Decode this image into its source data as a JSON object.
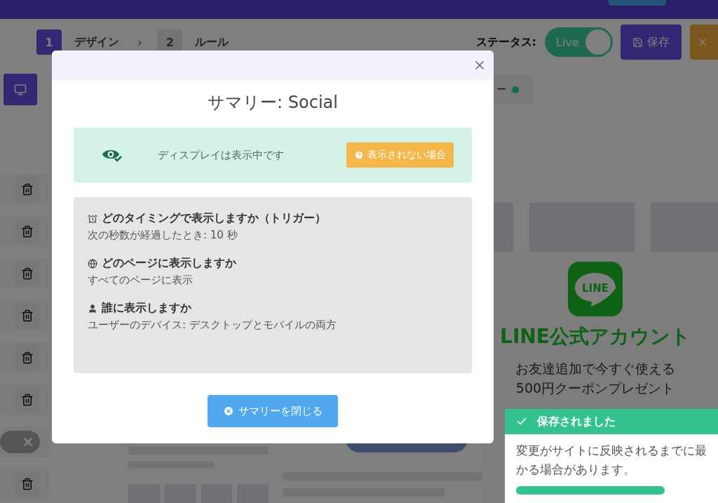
{
  "steps": [
    {
      "number": "1",
      "label": "デザイン",
      "selected": true
    },
    {
      "number": "2",
      "label": "ルール",
      "selected": false
    }
  ],
  "step_separator": "›",
  "status": {
    "label": "ステータス:",
    "toggle_text": "Live",
    "on": true
  },
  "save_button": "保存",
  "sidebar_rows": [
    {
      "kind": "actions"
    },
    {
      "kind": "actions"
    },
    {
      "kind": "actions"
    },
    {
      "kind": "actions"
    },
    {
      "kind": "actions"
    },
    {
      "kind": "actions"
    },
    {
      "kind": "toggle",
      "on": false
    },
    {
      "kind": "actions"
    }
  ],
  "preview_tab": {
    "label": "ー"
  },
  "preview": {
    "logo_text": "LINE",
    "title": "LINE公式アカウント",
    "lines": [
      "お友達追加で今すぐ使える",
      "500円クーポンプレゼント"
    ]
  },
  "modal": {
    "title": "サマリー: Social",
    "status_text": "ディスプレイは表示中です",
    "help_button": "表示されない場合",
    "sections": [
      {
        "kind": "timing",
        "heading": "どのタイミングで表示しますか（トリガー）",
        "detail": "次の秒数が経過したとき: 10 秒"
      },
      {
        "kind": "pages",
        "heading": "どのページに表示しますか",
        "detail": "すべてのページに表示"
      },
      {
        "kind": "audience",
        "heading": "誰に表示しますか",
        "detail": "ユーザーのデバイス: デスクトップとモバイルの両方"
      }
    ],
    "close_button": "サマリーを閉じる"
  },
  "toast": {
    "title": "保存されました",
    "lines": [
      "変更がサイトに反映されるまでに最",
      "かる場合があります。"
    ],
    "level": 0.78
  }
}
